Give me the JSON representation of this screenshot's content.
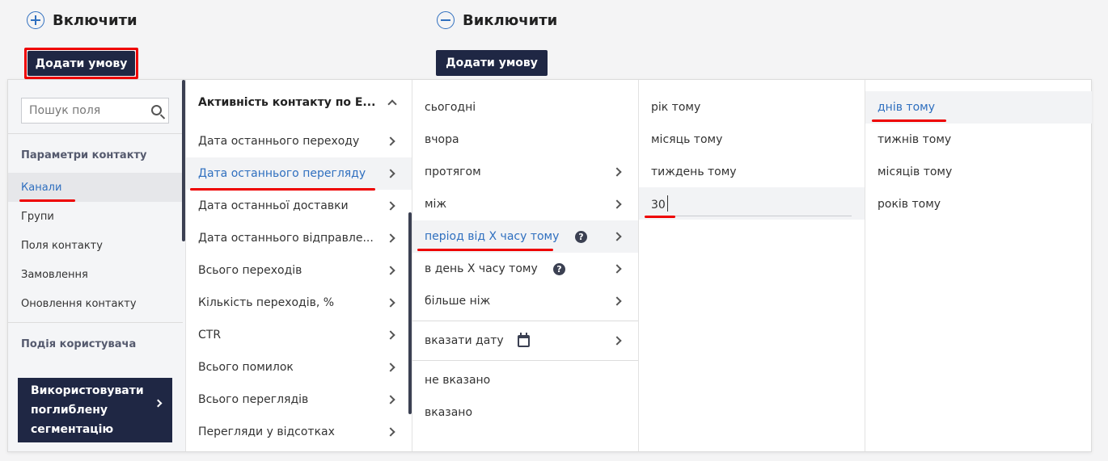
{
  "include": {
    "title": "Включити",
    "add_label": "Додати умову"
  },
  "exclude": {
    "title": "Виключити",
    "add_label": "Додати умову"
  },
  "sidebar": {
    "search_placeholder": "Пошук поля",
    "section1": "Параметри контакту",
    "items": [
      "Канали",
      "Групи",
      "Поля контакту",
      "Замовлення",
      "Оновлення контакту"
    ],
    "section2": "Подія користувача",
    "deep_segmentation": "Використовувати поглиблену сегментацію"
  },
  "col2": {
    "header": "Активність контакту по E...",
    "items": [
      "Дата останнього переходу",
      "Дата останнього перегляду",
      "Дата останньої доставки",
      "Дата останнього відправле...",
      "Всього переходів",
      "Кількість переходів, %",
      "CTR",
      "Всього помилок",
      "Всього переглядів",
      "Перегляди у відсотках"
    ]
  },
  "col3": {
    "items": [
      "сьогодні",
      "вчора",
      "протягом",
      "між",
      "період від X часу тому",
      "в день X часу тому",
      "більше ніж"
    ],
    "specify_date": "вказати дату",
    "not_specified": "не вказано",
    "specified": "вказано"
  },
  "col4": {
    "items": [
      "рік тому",
      "місяць тому",
      "тиждень тому"
    ],
    "input_value": "30"
  },
  "col5": {
    "items": [
      "днів тому",
      "тижнів тому",
      "місяців тому",
      "років тому"
    ]
  },
  "colors": {
    "accent": "#2f6fbf",
    "dark_button": "#1f2744",
    "highlight": "#ee0000"
  }
}
